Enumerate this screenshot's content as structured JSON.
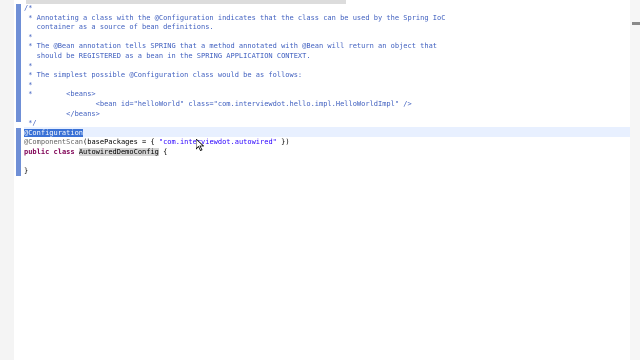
{
  "editor": {
    "lines": [
      {
        "text": "/*"
      },
      {
        "text": " * Annotating a class with the @Configuration indicates that the class can be used by the Spring IoC"
      },
      {
        "text": "   container as a source of bean definitions."
      },
      {
        "text": " *"
      },
      {
        "text": " * The @Bean annotation tells SPRING that a method annotated with @Bean will return an object that"
      },
      {
        "text": "   should be REGISTERED as a bean in the SPRING APPLICATION CONTEXT."
      },
      {
        "text": " *"
      },
      {
        "text": " * The simplest possible @Configuration class would be as follows:"
      },
      {
        "text": " *"
      },
      {
        "text": " *        <beans>"
      },
      {
        "text": "                 <bean id=\"helloWorld\" class=\"com.interviewdot.hello.impl.HelloWorldImpl\" />"
      },
      {
        "text": "          </beans>"
      },
      {
        "text": " */"
      }
    ],
    "annotation_config": "@Configuration",
    "annotation_scan": "@ComponentScan",
    "scan_attr": "(basePackages = { ",
    "scan_value": "\"com.interviewdot.autowired\"",
    "scan_close": " })",
    "class_kw1": "public",
    "class_kw2": "class",
    "class_name": "AutowiredDemoConfig",
    "class_open": " {",
    "blank": "",
    "class_close": "}"
  }
}
